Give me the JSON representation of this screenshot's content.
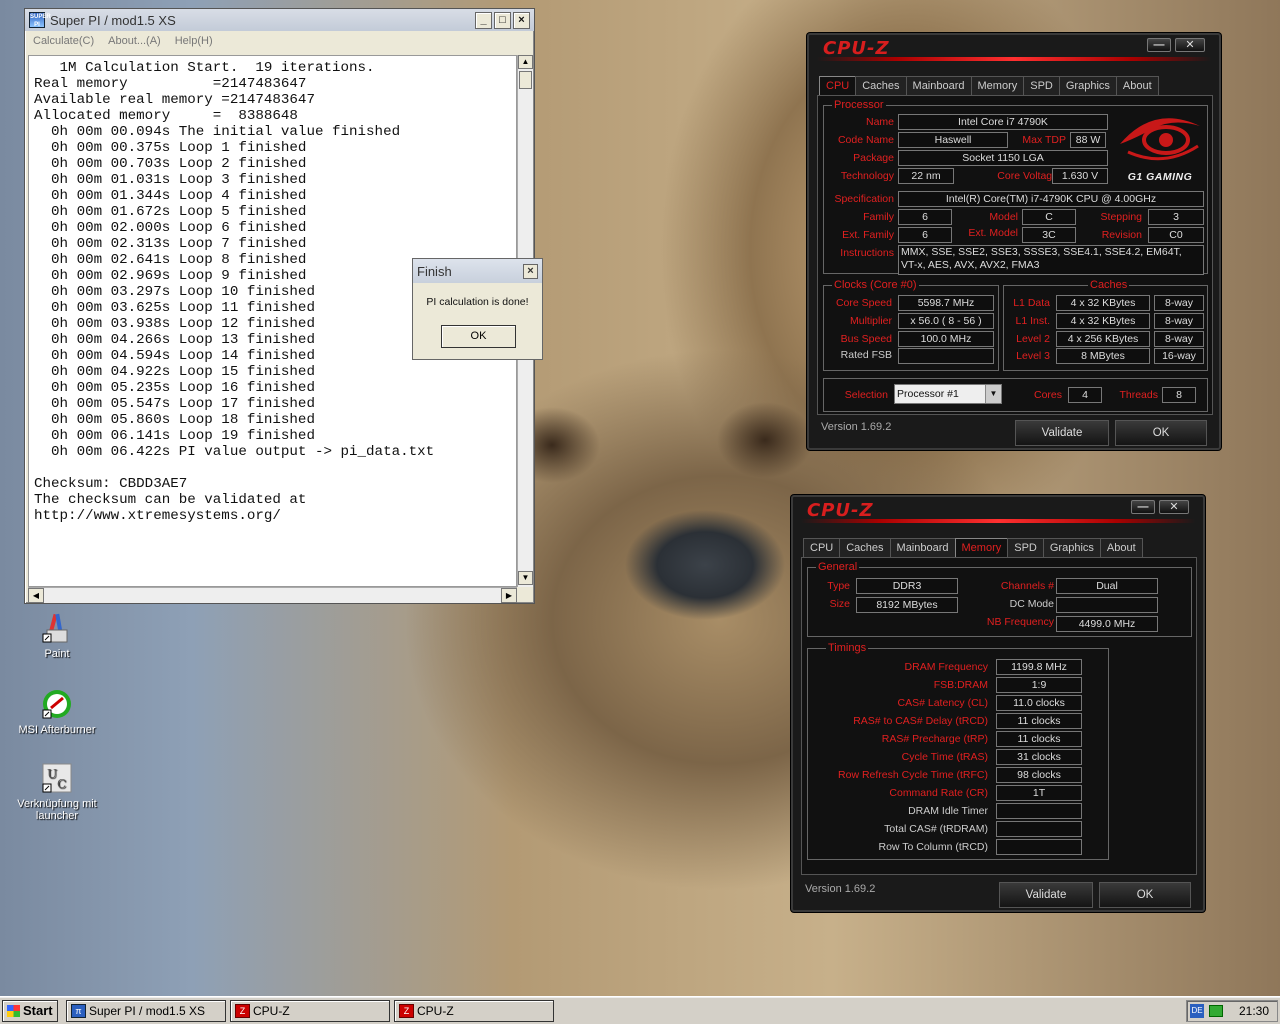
{
  "superpi": {
    "title": "Super PI / mod1.5 XS",
    "menu": [
      "Calculate(C)",
      "About...(A)",
      "Help(H)"
    ],
    "lines": [
      "   1M Calculation Start.  19 iterations.",
      "Real memory          =2147483647",
      "Available real memory =2147483647",
      "Allocated memory     =  8388648",
      "  0h 00m 00.094s The initial value finished",
      "  0h 00m 00.375s Loop 1 finished",
      "  0h 00m 00.703s Loop 2 finished",
      "  0h 00m 01.031s Loop 3 finished",
      "  0h 00m 01.344s Loop 4 finished",
      "  0h 00m 01.672s Loop 5 finished",
      "  0h 00m 02.000s Loop 6 finished",
      "  0h 00m 02.313s Loop 7 finished",
      "  0h 00m 02.641s Loop 8 finished",
      "  0h 00m 02.969s Loop 9 finished",
      "  0h 00m 03.297s Loop 10 finished",
      "  0h 00m 03.625s Loop 11 finished",
      "  0h 00m 03.938s Loop 12 finished",
      "  0h 00m 04.266s Loop 13 finished",
      "  0h 00m 04.594s Loop 14 finished",
      "  0h 00m 04.922s Loop 15 finished",
      "  0h 00m 05.235s Loop 16 finished",
      "  0h 00m 05.547s Loop 17 finished",
      "  0h 00m 05.860s Loop 18 finished",
      "  0h 00m 06.141s Loop 19 finished",
      "  0h 00m 06.422s PI value output -> pi_data.txt",
      "",
      "Checksum: CBDD3AE7",
      "The checksum can be validated at",
      "http://www.xtremesystems.org/"
    ]
  },
  "finish": {
    "title": "Finish",
    "message": "PI calculation is done!",
    "ok": "OK"
  },
  "cpuz1": {
    "logo": "CPU-Z",
    "tabs": [
      "CPU",
      "Caches",
      "Mainboard",
      "Memory",
      "SPD",
      "Graphics",
      "About"
    ],
    "processor_label": "Processor",
    "name_l": "Name",
    "name": "Intel Core i7 4790K",
    "codename_l": "Code Name",
    "codename": "Haswell",
    "tdp_l": "Max TDP",
    "tdp": "88 W",
    "package_l": "Package",
    "package": "Socket 1150 LGA",
    "tech_l": "Technology",
    "tech": "22 nm",
    "cv_l": "Core Voltage",
    "cv": "1.630 V",
    "spec_l": "Specification",
    "spec": "Intel(R) Core(TM) i7-4790K CPU @ 4.00GHz",
    "family_l": "Family",
    "family": "6",
    "model_l": "Model",
    "model": "C",
    "stepping_l": "Stepping",
    "stepping": "3",
    "extfam_l": "Ext. Family",
    "extfam": "6",
    "extmod_l": "Ext. Model",
    "extmod": "3C",
    "rev_l": "Revision",
    "rev": "C0",
    "instr_l": "Instructions",
    "instr1": "MMX, SSE, SSE2, SSE3, SSSE3, SSE4.1, SSE4.2, EM64T,",
    "instr2": "VT-x, AES, AVX, AVX2, FMA3",
    "gaming": "G1 GAMING",
    "clocks_label": "Clocks (Core #0)",
    "cs_l": "Core Speed",
    "cs": "5598.7 MHz",
    "mul_l": "Multiplier",
    "mul": "x 56.0 ( 8 - 56 )",
    "bus_l": "Bus Speed",
    "bus": "100.0 MHz",
    "fsb_l": "Rated FSB",
    "fsb": "",
    "caches_label": "Caches",
    "l1d_l": "L1 Data",
    "l1d": "4 x 32 KBytes",
    "l1d_w": "8-way",
    "l1i_l": "L1 Inst.",
    "l1i": "4 x 32 KBytes",
    "l1i_w": "8-way",
    "l2_l": "Level 2",
    "l2": "4 x 256 KBytes",
    "l2_w": "8-way",
    "l3_l": "Level 3",
    "l3": "8 MBytes",
    "l3_w": "16-way",
    "sel_l": "Selection",
    "sel": "Processor #1",
    "cores_l": "Cores",
    "cores": "4",
    "threads_l": "Threads",
    "threads": "8",
    "version": "Version 1.69.2",
    "validate": "Validate",
    "ok": "OK"
  },
  "cpuz2": {
    "logo": "CPU-Z",
    "tabs": [
      "CPU",
      "Caches",
      "Mainboard",
      "Memory",
      "SPD",
      "Graphics",
      "About"
    ],
    "general_label": "General",
    "type_l": "Type",
    "type": "DDR3",
    "size_l": "Size",
    "size": "8192 MBytes",
    "ch_l": "Channels #",
    "ch": "Dual",
    "dc_l": "DC Mode",
    "dc": "",
    "nb_l": "NB Frequency",
    "nb": "4499.0 MHz",
    "timings_label": "Timings",
    "timings": [
      {
        "l": "DRAM Frequency",
        "v": "1199.8 MHz",
        "red": true
      },
      {
        "l": "FSB:DRAM",
        "v": "1:9",
        "red": true
      },
      {
        "l": "CAS# Latency (CL)",
        "v": "11.0 clocks",
        "red": true
      },
      {
        "l": "RAS# to CAS# Delay (tRCD)",
        "v": "11 clocks",
        "red": true
      },
      {
        "l": "RAS# Precharge (tRP)",
        "v": "11 clocks",
        "red": true
      },
      {
        "l": "Cycle Time (tRAS)",
        "v": "31 clocks",
        "red": true
      },
      {
        "l": "Row Refresh Cycle Time (tRFC)",
        "v": "98 clocks",
        "red": true
      },
      {
        "l": "Command Rate (CR)",
        "v": "1T",
        "red": true
      },
      {
        "l": "DRAM Idle Timer",
        "v": "",
        "red": false
      },
      {
        "l": "Total CAS# (tRDRAM)",
        "v": "",
        "red": false
      },
      {
        "l": "Row To Column (tRCD)",
        "v": "",
        "red": false
      }
    ],
    "version": "Version 1.69.2",
    "validate": "Validate",
    "ok": "OK"
  },
  "desktop": [
    {
      "name": "paint",
      "label": "Paint"
    },
    {
      "name": "msi-afterburner",
      "label": "MSI Afterburner"
    },
    {
      "name": "launcher",
      "label": "Verknüpfung mit launcher"
    }
  ],
  "taskbar": {
    "start": "Start",
    "items": [
      "Super PI / mod1.5 XS",
      "CPU-Z",
      "CPU-Z"
    ],
    "lang": "DE",
    "time": "21:30"
  }
}
